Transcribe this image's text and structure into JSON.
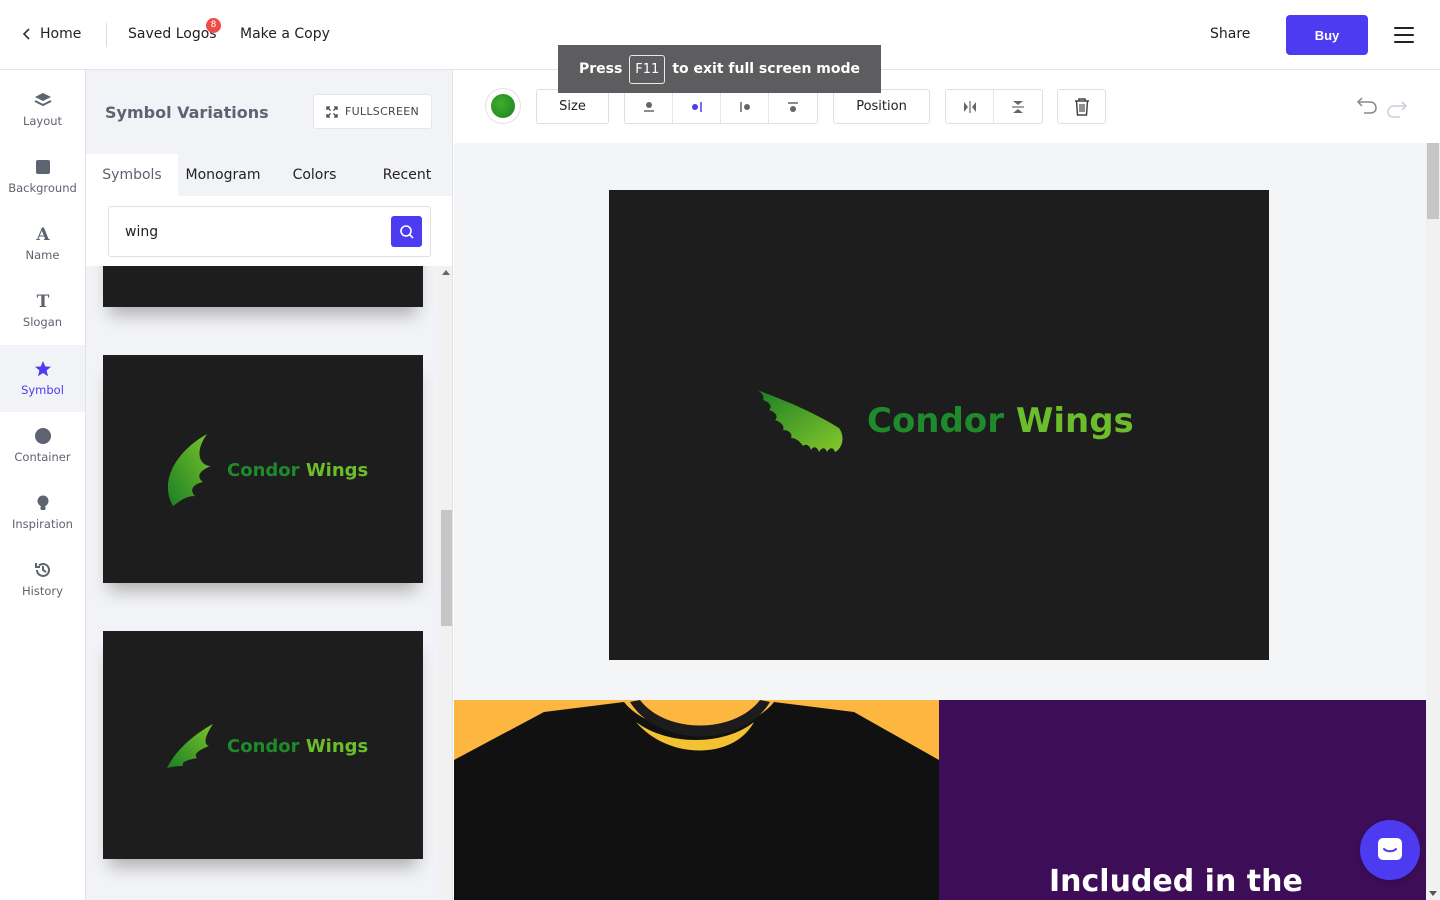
{
  "topbar": {
    "home_label": "Home",
    "saved_label": "Saved Logos",
    "saved_count": "8",
    "copy_label": "Make a Copy",
    "share_label": "Share",
    "buy_label": "Buy"
  },
  "toast": {
    "prefix": "Press",
    "key": "F11",
    "suffix": "to exit full screen mode"
  },
  "leftnav": {
    "items": [
      {
        "label": "Layout",
        "icon": "layers-icon"
      },
      {
        "label": "Background",
        "icon": "square-icon"
      },
      {
        "label": "Name",
        "icon": "letter-a-icon"
      },
      {
        "label": "Slogan",
        "icon": "letter-t-icon"
      },
      {
        "label": "Symbol",
        "icon": "star-icon",
        "active": true
      },
      {
        "label": "Container",
        "icon": "circle-icon"
      },
      {
        "label": "Inspiration",
        "icon": "lightbulb-icon"
      },
      {
        "label": "History",
        "icon": "history-icon"
      }
    ]
  },
  "panel": {
    "title": "Symbol Variations",
    "fullscreen_label": "FULLSCREEN",
    "tabs": [
      "Symbols",
      "Monogram",
      "Colors",
      "Recent"
    ],
    "active_tab": "Symbols",
    "search_value": "wing",
    "cards": [
      {
        "name_part1": "Condor",
        "name_part2": "Wings",
        "icon": "wing-icon"
      },
      {
        "name_part1": "Condor",
        "name_part2": "Wings",
        "icon": "leaf-wing-icon"
      },
      {
        "name_part1": "Condor",
        "name_part2": "Wings",
        "icon": "thin-wing-icon"
      }
    ]
  },
  "toolbar": {
    "color": "#2a9a2a",
    "size_label": "Size",
    "position_label": "Position",
    "align_icons": [
      "align-top-icon",
      "align-right-icon",
      "align-left-icon",
      "align-bottom-icon"
    ],
    "flip_icons": [
      "flip-horizontal-icon",
      "flip-vertical-icon"
    ],
    "delete_icon": "trash-icon"
  },
  "canvas": {
    "name_part1": "Condor",
    "name_part2": "Wings",
    "mockup_headline": "Included in the"
  },
  "colors": {
    "accent": "#4c3bf0",
    "logo_dark_green": "#1f8a2c",
    "logo_light_green": "#6cbd2b",
    "canvas_bg": "#1d1d1d",
    "shirt_bg": "#fdb740",
    "purple_bg": "#3e0d58"
  }
}
